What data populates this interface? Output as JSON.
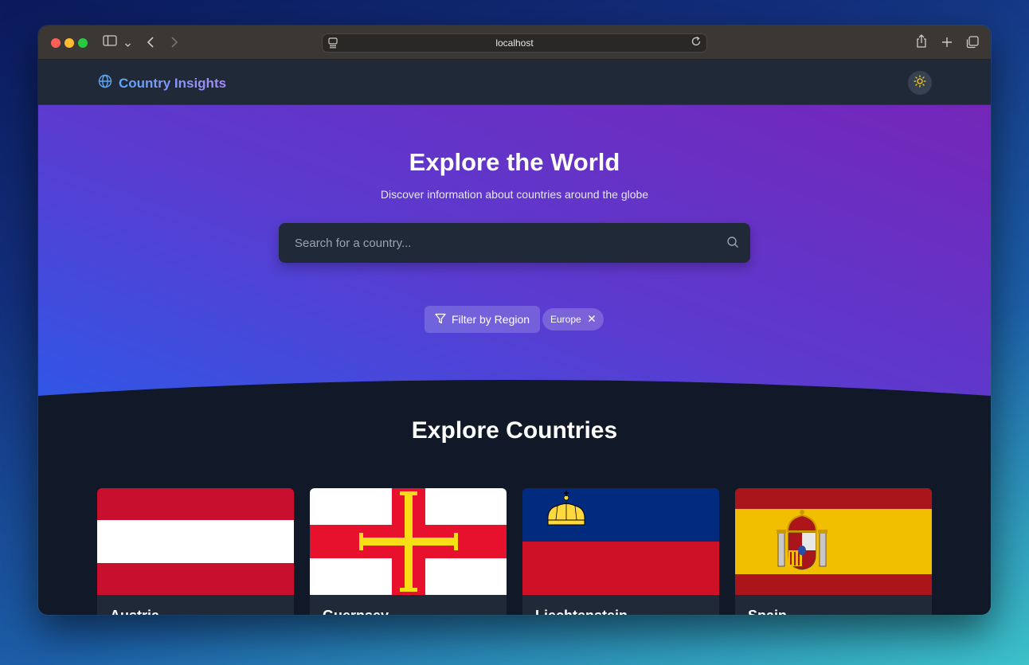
{
  "browser": {
    "url": "localhost"
  },
  "nav": {
    "brand": "Country Insights",
    "theme_toggle_icon": "sun-icon"
  },
  "hero": {
    "title": "Explore the World",
    "subtitle": "Discover information about countries around the globe",
    "search_placeholder": "Search for a country...",
    "search_value": "",
    "filter_label": "Filter by Region",
    "active_filter": "Europe"
  },
  "section": {
    "title": "Explore Countries"
  },
  "countries": [
    {
      "name": "Austria",
      "flag": "austria-flag-icon"
    },
    {
      "name": "Guernsey",
      "flag": "guernsey-flag-icon"
    },
    {
      "name": "Liechtenstein",
      "flag": "liechtenstein-flag-icon"
    },
    {
      "name": "Spain",
      "flag": "spain-flag-icon"
    }
  ],
  "colors": {
    "brand_gradient_start": "#60a5fa",
    "brand_gradient_end": "#a78bfa",
    "page_bg": "#111827",
    "card_bg": "#1f2937"
  }
}
